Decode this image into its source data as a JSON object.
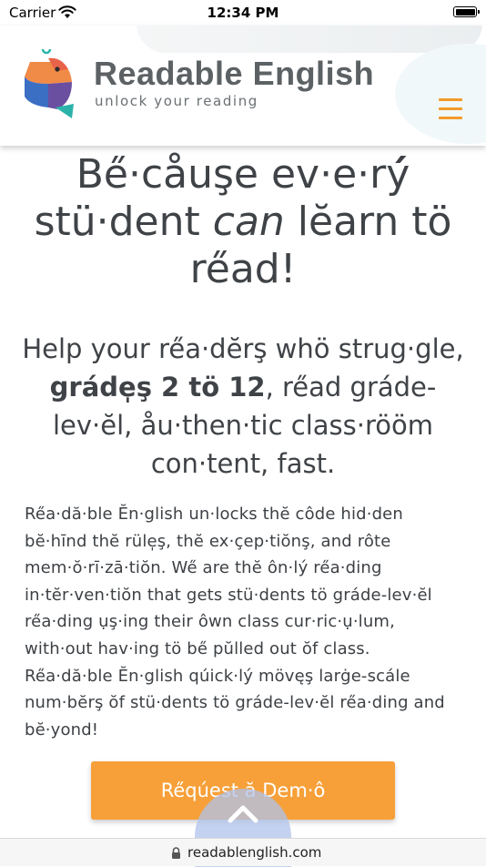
{
  "status_bar": {
    "carrier": "Carrier",
    "time": "12:34 PM",
    "icons": [
      "wifi-icon",
      "battery-icon"
    ]
  },
  "header": {
    "brand_name": "Readable English",
    "tagline": "unlock your reading",
    "menu_icon": "hamburger-icon",
    "colors": {
      "accent": "#f39a2b",
      "logo_orange": "#f08a47",
      "logo_blue": "#3b6fc4",
      "logo_purple": "#6a4fa0",
      "logo_teal": "#2bb3a9"
    }
  },
  "hero": {
    "title_part1": "Be̋·cåuşe ev·e·rý́",
    "title_part2": "stü·dent ",
    "title_em": "can",
    "title_part3": " lĕarn tö",
    "title_part4": "re̋ad!",
    "subtitle_part1": "Help your re̋a·dĕrş whö strug·gle, ",
    "subtitle_bold": "gráde̩ş 2 tö 12",
    "subtitle_part2": ", re̋ad gráde-lev·ĕl, åu·then·tic class·rööm con·tent, fast."
  },
  "body": {
    "paragraph": "Re̋a·dă·ble Ĕn·glish un·locks thĕ côde hid·den bĕ·hīnd thĕ rüle̩ş, thĕ ex·çep·tiŏnş, and rôte mem·ŏ·rī·zā·tiŏn. We̋ are thĕ ôn·lý re̋a·ding in·tĕr·ven·tiŏn that gets stü·dents tö gráde-lev·ĕl re̋a·ding ụş·ing their ôwn class cur·ric·ụ·lum, with·out hav·ing tö be̋ pŭlled out ŏf class. Re̋a·dă·ble Ĕn·glish qúick·lý mövęş larġe-scále num·bĕrş ŏf stü·dents tö gráde-lev·ĕl re̋a·ding and bĕ·yond!"
  },
  "cta": {
    "label": "Re̋qúest ă Dem·ô",
    "color": "#f7a039",
    "scroll_icon": "chevron-up-icon"
  },
  "url_bar": {
    "url": "readablenglish.com",
    "icon": "lock-icon"
  }
}
